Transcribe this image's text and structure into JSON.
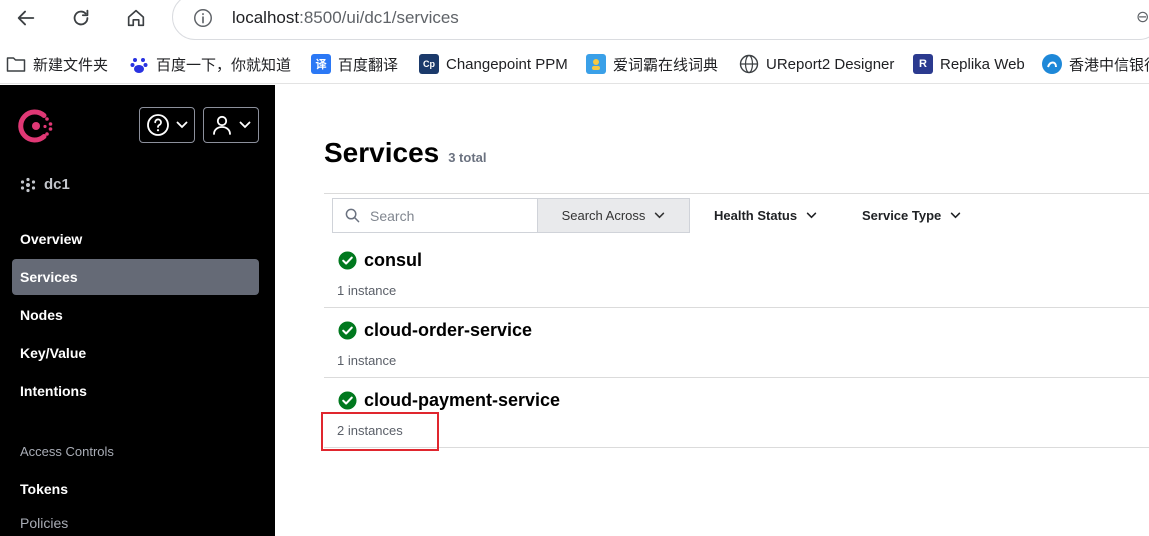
{
  "browser": {
    "url_host": "localhost",
    "url_path": ":8500/ui/dc1/services",
    "bookmarks": [
      {
        "label": "新建文件夹",
        "icon": "folder-icon"
      },
      {
        "label": "百度一下，你就知道",
        "icon": "baidu-icon"
      },
      {
        "label": "百度翻译",
        "icon": "translate-icon"
      },
      {
        "label": "Changepoint PPM",
        "icon": "changepoint-icon"
      },
      {
        "label": "爱词霸在线词典",
        "icon": "iciba-icon"
      },
      {
        "label": "UReport2 Designer",
        "icon": "globe-icon"
      },
      {
        "label": "Replika Web",
        "icon": "replika-icon"
      },
      {
        "label": "香港中信银行",
        "icon": "bank-icon"
      }
    ]
  },
  "sidebar": {
    "datacenter": "dc1",
    "items": [
      {
        "label": "Overview"
      },
      {
        "label": "Services"
      },
      {
        "label": "Nodes"
      },
      {
        "label": "Key/Value"
      },
      {
        "label": "Intentions"
      }
    ],
    "access_section": "Access Controls",
    "access_items": [
      {
        "label": "Tokens"
      },
      {
        "label": "Policies"
      }
    ]
  },
  "main": {
    "title": "Services",
    "total": "3 total",
    "search_placeholder": "Search",
    "search_across": "Search Across",
    "health_status": "Health Status",
    "service_type": "Service Type",
    "services": [
      {
        "name": "consul",
        "instances": "1 instance",
        "status": "passing"
      },
      {
        "name": "cloud-order-service",
        "instances": "1 instance",
        "status": "passing"
      },
      {
        "name": "cloud-payment-service",
        "instances": "2 instances",
        "status": "passing"
      }
    ]
  },
  "colors": {
    "brand": "#e03875",
    "passing": "#00781e",
    "sidebar_bg": "#000000",
    "active_item": "#656a76",
    "highlight": "#e0262e"
  }
}
